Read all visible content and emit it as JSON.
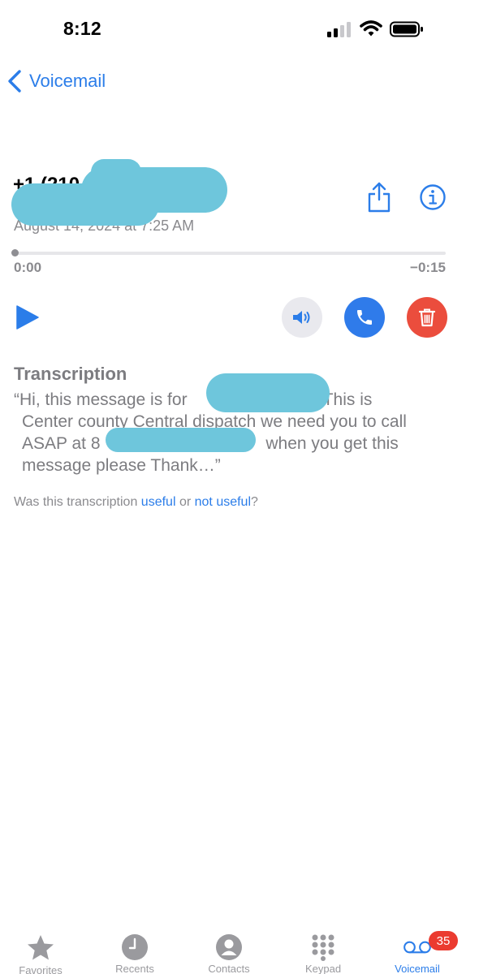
{
  "status_bar": {
    "time": "8:12"
  },
  "nav": {
    "back_label": "Voicemail"
  },
  "voicemail": {
    "caller_visible": "+1 (210",
    "date_visible": "August 14, 2024 at 7:25 AM",
    "elapsed": "0:00",
    "remaining": "−0:15",
    "progress": 0
  },
  "transcription": {
    "title": "Transcription",
    "lines": [
      {
        "before": "“Hi, this message is for ",
        "after": ". This is"
      },
      {
        "text": "Center county Central dispatch we need you to call"
      },
      {
        "before": "ASAP at 8",
        "after": " when you get this"
      },
      {
        "text": "message please Thank…”"
      }
    ],
    "feedback": {
      "prefix": "Was this transcription ",
      "useful": "useful",
      "middle": " or ",
      "not_useful": "not useful",
      "suffix": "?"
    }
  },
  "tab_bar": {
    "tabs": [
      {
        "label": "Favorites",
        "icon": "star-icon"
      },
      {
        "label": "Recents",
        "icon": "clock-icon"
      },
      {
        "label": "Contacts",
        "icon": "person-icon"
      },
      {
        "label": "Keypad",
        "icon": "keypad-icon"
      },
      {
        "label": "Voicemail",
        "icon": "voicemail-icon",
        "active": true,
        "badge": "35"
      }
    ]
  },
  "colors": {
    "accent": "#2b7de9",
    "call": "#2f7bea",
    "delete": "#eb4d3d",
    "badge": "#eb3b30",
    "redaction": "#6ec6dc"
  }
}
